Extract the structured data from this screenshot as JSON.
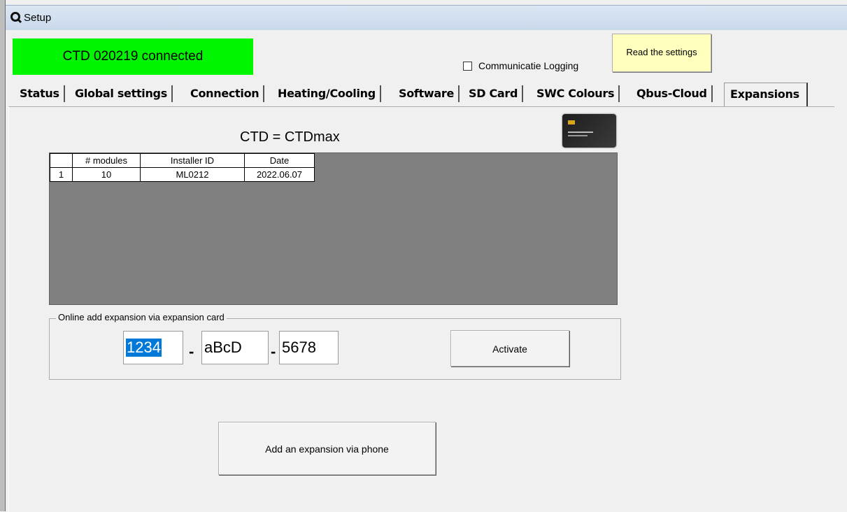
{
  "window": {
    "title": "Setup"
  },
  "status": {
    "text": "CTD 020219 connected",
    "color": "#00f500"
  },
  "logging": {
    "label": "Communicatie Logging",
    "checked": false
  },
  "read_button": {
    "label": "Read the settings"
  },
  "tabs": [
    {
      "label": "Status"
    },
    {
      "label": "Global settings"
    },
    {
      "label": "Connection"
    },
    {
      "label": "Heating/Cooling"
    },
    {
      "label": "Software"
    },
    {
      "label": "SD Card"
    },
    {
      "label": "SWC Colours"
    },
    {
      "label": "Qbus-Cloud"
    },
    {
      "label": "Expansions",
      "active": true
    }
  ],
  "expansions": {
    "title": "CTD = CTDmax",
    "table": {
      "columns": [
        "# modules",
        "Installer ID",
        "Date"
      ],
      "rows": [
        {
          "num": "1",
          "modules": "10",
          "installer": "ML0212",
          "date": "2022.06.07"
        }
      ]
    },
    "online_group": {
      "label": "Online add expansion via expansion card",
      "code1": "1234",
      "code2": "aBcD",
      "code3": "5678",
      "separator": "-",
      "activate_label": "Activate"
    },
    "phone_button": {
      "label": "Add an expansion via phone"
    }
  }
}
